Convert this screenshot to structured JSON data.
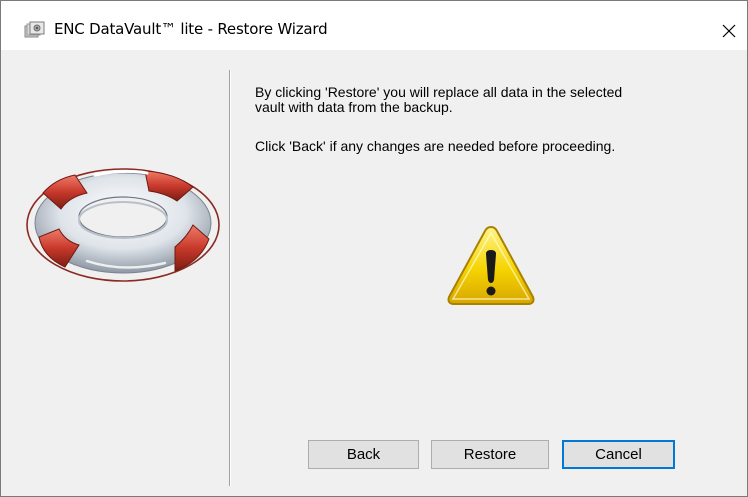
{
  "window": {
    "title": "ENC DataVault™ lite - Restore Wizard",
    "close_glyph": "✕"
  },
  "icons": {
    "app": "vault-app-icon",
    "close": "close-icon",
    "illustration": "lifebuoy-icon",
    "warning": "warning-icon"
  },
  "content": {
    "message_line1": "By clicking 'Restore' you will replace all data in the selected",
    "message_line2": "vault with data from the backup.",
    "message_back": "Click 'Back' if any changes are needed before proceeding."
  },
  "buttons": {
    "back_label": "Back",
    "restore_label": "Restore",
    "cancel_label": "Cancel",
    "default_button": "Cancel"
  },
  "colors": {
    "window_bg": "#f0f0f0",
    "titlebar_bg": "#ffffff",
    "button_bg": "#e1e1e1",
    "focus_border": "#0078d7",
    "warning_yellow": "#f5d400",
    "lifebuoy_red": "#c8392b"
  }
}
